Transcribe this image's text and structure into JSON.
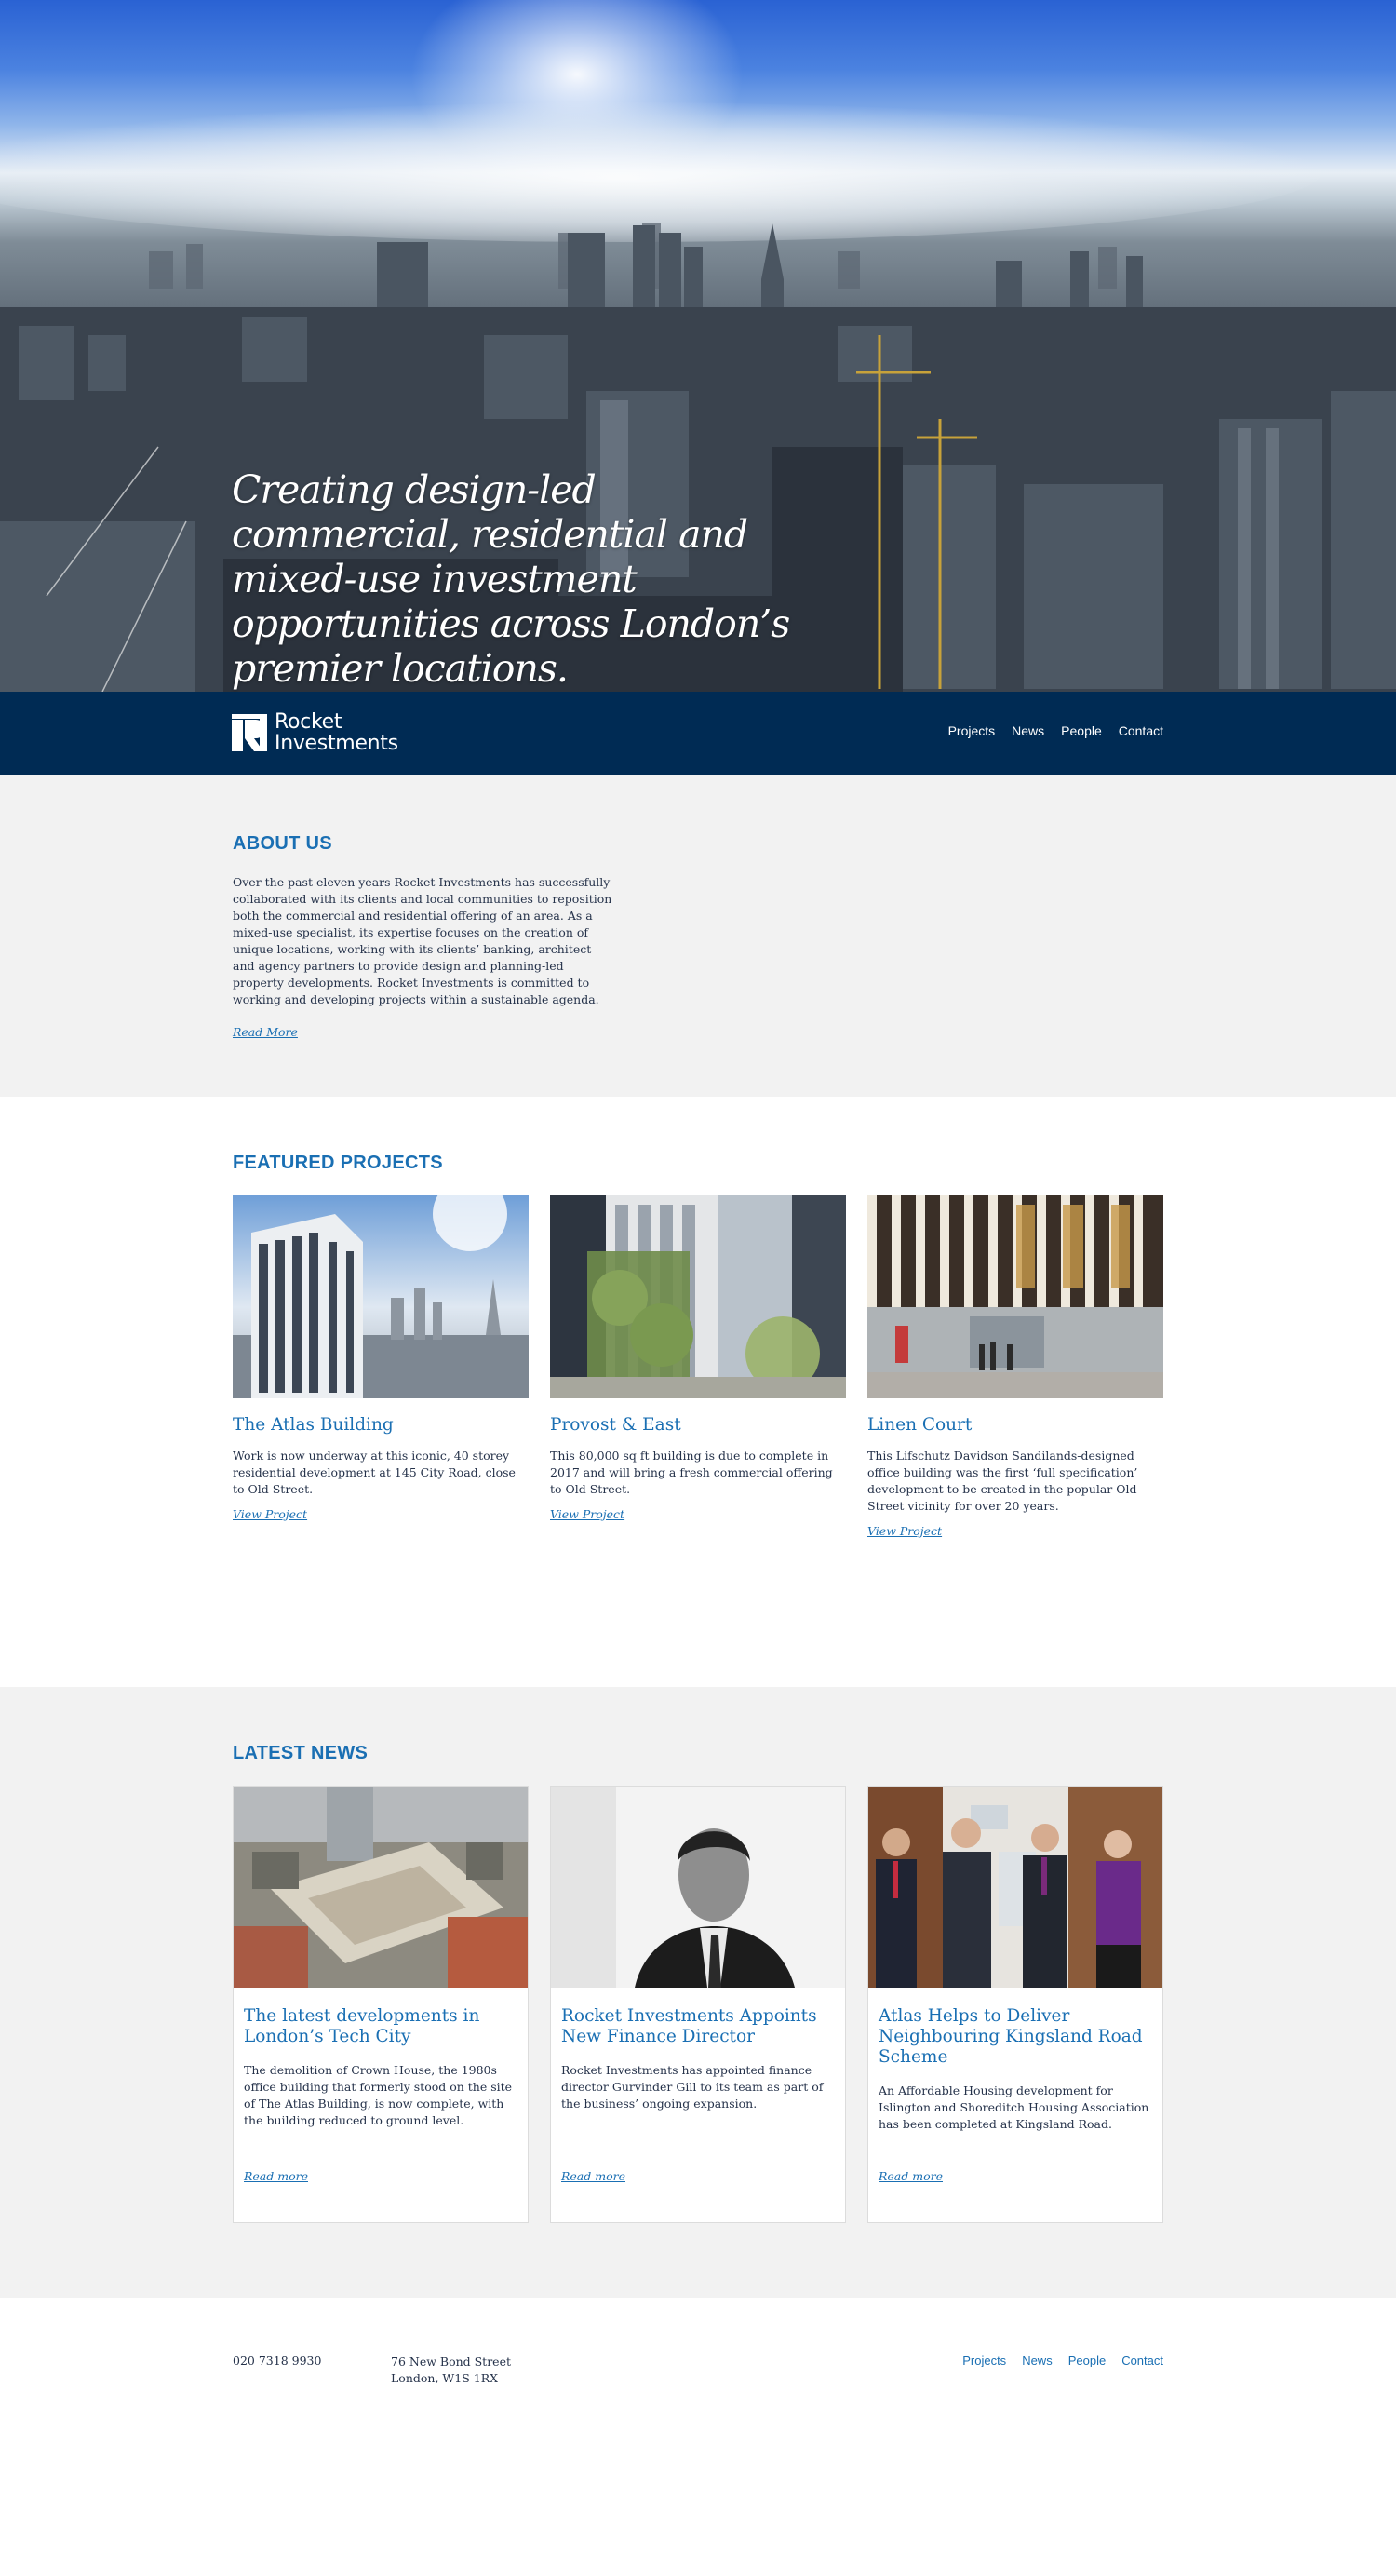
{
  "hero": {
    "tagline": "Creating design-led commercial, residential and mixed-use investment opportunities across London’s premier locations."
  },
  "brand": {
    "mark": "RI",
    "line1": "Rocket",
    "line2": "Investments",
    "colors": {
      "navy": "#002b54",
      "accent": "#1a6fb3",
      "panel": "#f2f2f2"
    }
  },
  "nav": {
    "items": [
      "Projects",
      "News",
      "People",
      "Contact"
    ]
  },
  "about": {
    "heading": "ABOUT US",
    "body": "Over the past eleven years Rocket Investments has successfully collaborated with its clients and local communities to reposition both the commercial and residential offering of an area. As a mixed-use specialist, its expertise focuses on the creation of unique locations, working with its clients’ banking, architect and agency partners to provide design and planning-led property developments. Rocket Investments is committed to working and developing projects within a sustainable agenda.",
    "read_more": "Read More"
  },
  "featured": {
    "heading": "FEATURED PROJECTS",
    "projects": [
      {
        "title": "The Atlas Building",
        "desc": "Work is now underway at this iconic, 40 storey residential development at 145 City Road, close to Old Street.",
        "link": "View Project"
      },
      {
        "title": "Provost & East",
        "desc": "This 80,000 sq ft building is due to complete in 2017 and will bring a fresh commercial offering to Old Street.",
        "link": "View Project"
      },
      {
        "title": "Linen Court",
        "desc": "This Lifschutz Davidson Sandilands-designed office building was the first ‘full specification’ development to be created in the popular Old Street vicinity for over 20 years.",
        "link": "View Project"
      }
    ]
  },
  "news": {
    "heading": "LATEST NEWS",
    "items": [
      {
        "title": "The latest developments in London’s Tech City",
        "desc": "The demolition of Crown House, the 1980s office building that formerly stood on the site of The Atlas Building, is now complete, with the building reduced to ground level.",
        "link": "Read more"
      },
      {
        "title": "Rocket Investments Appoints New Finance Director",
        "desc": "Rocket Investments has appointed finance director Gurvinder Gill to its team as part of the business’ ongoing expansion.",
        "link": "Read more"
      },
      {
        "title": "Atlas Helps to Deliver Neighbouring Kingsland Road Scheme",
        "desc": "An Affordable Housing development for Islington and Shoreditch Housing Association has been completed at Kingsland Road.",
        "link": "Read more"
      }
    ]
  },
  "footer": {
    "phone": "020 7318 9930",
    "address_line1": "76 New Bond Street",
    "address_line2": "London, W1S 1RX",
    "nav": [
      "Projects",
      "News",
      "People",
      "Contact"
    ]
  }
}
